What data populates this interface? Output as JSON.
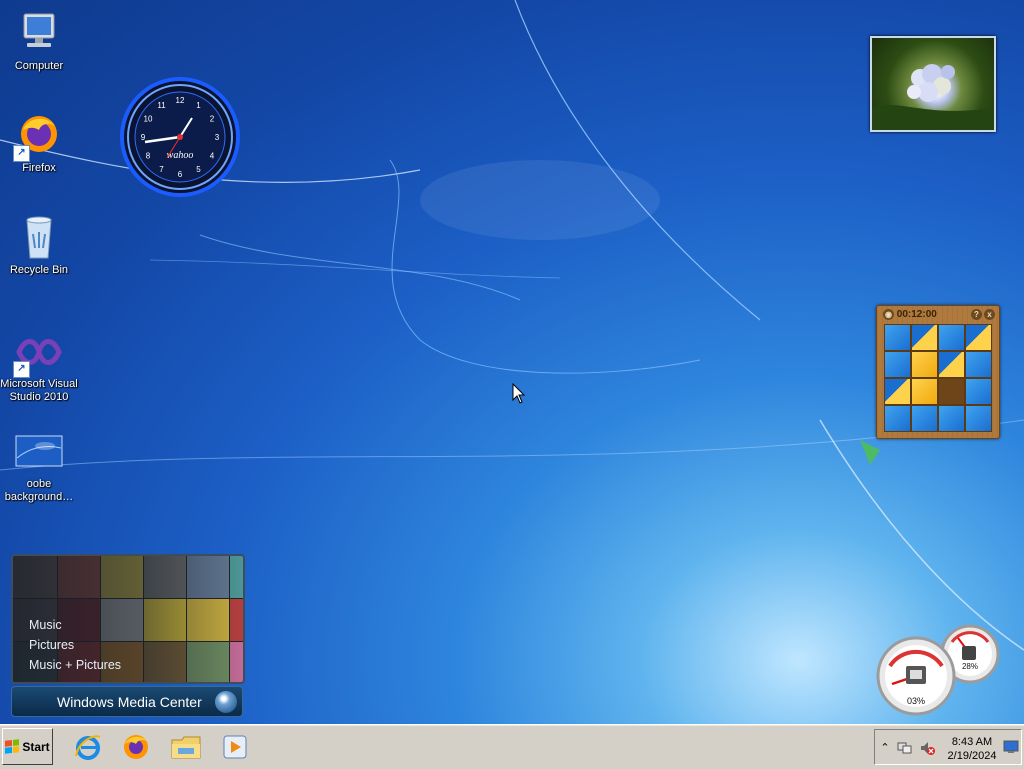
{
  "desktop": {
    "icons": [
      {
        "label": "Computer",
        "icon": "computer-icon"
      },
      {
        "label": "Firefox",
        "icon": "firefox-icon"
      },
      {
        "label": "Recycle Bin",
        "icon": "recycle-bin-icon"
      },
      {
        "label": "Microsoft Visual Studio 2010",
        "icon": "visual-studio-icon"
      },
      {
        "label": "oobe background…",
        "icon": "image-file-icon"
      }
    ]
  },
  "clock_gadget": {
    "brand": "wahoo",
    "numerals": [
      "12",
      "1",
      "2",
      "3",
      "4",
      "5",
      "6",
      "7",
      "8",
      "9",
      "10",
      "11"
    ],
    "accent": "#2f6bff"
  },
  "puzzle_gadget": {
    "timer": "00:12:00",
    "help_label": "?",
    "close_label": "x"
  },
  "media_center": {
    "menu": [
      "Music",
      "Pictures",
      "Music + Pictures"
    ],
    "brand_left": "Windows",
    "brand_right": "Media Center"
  },
  "meter_gadget": {
    "cpu_percent": "03%",
    "memory_percent": "28%"
  },
  "taskbar": {
    "start_label": "Start",
    "pinned": [
      "internet-explorer-icon",
      "firefox-icon",
      "file-explorer-icon",
      "media-player-icon"
    ],
    "time": "8:43 AM",
    "date": "2/19/2024"
  },
  "colors": {
    "taskbar": "#d4d0c8",
    "desktop_blue": "#1c5fc6"
  }
}
